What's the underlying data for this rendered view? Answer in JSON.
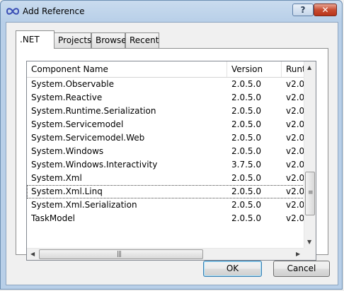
{
  "window": {
    "title": "Add Reference",
    "help_label": "?",
    "close_label": "✕"
  },
  "tabs": [
    {
      "label": ".NET",
      "active": true
    },
    {
      "label": "Projects",
      "active": false
    },
    {
      "label": "Browse",
      "active": false
    },
    {
      "label": "Recent",
      "active": false
    }
  ],
  "table": {
    "columns": [
      "Component Name",
      "Version",
      "Runt"
    ],
    "rows": [
      {
        "name": "System.Observable",
        "version": "2.0.5.0",
        "runtime": "v2.0."
      },
      {
        "name": "System.Reactive",
        "version": "2.0.5.0",
        "runtime": "v2.0."
      },
      {
        "name": "System.Runtime.Serialization",
        "version": "2.0.5.0",
        "runtime": "v2.0."
      },
      {
        "name": "System.Servicemodel",
        "version": "2.0.5.0",
        "runtime": "v2.0."
      },
      {
        "name": "System.Servicemodel.Web",
        "version": "2.0.5.0",
        "runtime": "v2.0."
      },
      {
        "name": "System.Windows",
        "version": "2.0.5.0",
        "runtime": "v2.0."
      },
      {
        "name": "System.Windows.Interactivity",
        "version": "3.7.5.0",
        "runtime": "v2.0."
      },
      {
        "name": "System.Xml",
        "version": "2.0.5.0",
        "runtime": "v2.0."
      },
      {
        "name": "System.Xml.Linq",
        "version": "2.0.5.0",
        "runtime": "v2.0.",
        "selected": true
      },
      {
        "name": "System.Xml.Serialization",
        "version": "2.0.5.0",
        "runtime": "v2.0."
      },
      {
        "name": "TaskModel",
        "version": "2.0.5.0",
        "runtime": "v2.0."
      }
    ]
  },
  "buttons": {
    "ok": "OK",
    "cancel": "Cancel"
  },
  "icons": {
    "app": "infinity-icon",
    "scroll_up": "scroll-up-arrow-icon",
    "scroll_down": "scroll-down-arrow-icon",
    "scroll_left": "scroll-left-arrow-icon",
    "scroll_right": "scroll-right-arrow-icon"
  },
  "colors": {
    "title_bar": "#b8cfe8",
    "close_button": "#c84c31",
    "ok_border": "#3c7fb1"
  }
}
